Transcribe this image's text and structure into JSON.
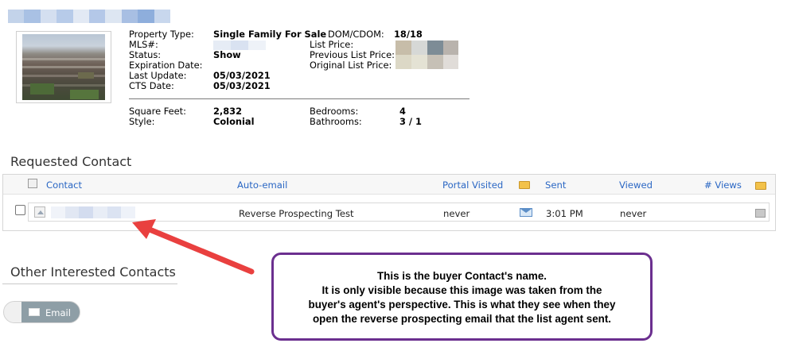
{
  "property": {
    "photo_alt": "property-photo",
    "fields": {
      "property_type_label": "Property Type:",
      "property_type_value": "Single Family For Sale",
      "dom_label": "DOM/CDOM:",
      "dom_value": "18/18",
      "mls_label": "MLS#:",
      "list_price_label": "List Price:",
      "status_label": "Status:",
      "status_value": "Show",
      "prev_price_label": "Previous List Price:",
      "expiration_label": "Expiration Date:",
      "orig_price_label": "Original List Price:",
      "last_update_label": "Last Update:",
      "last_update_value": "05/03/2021",
      "cts_label": "CTS Date:",
      "cts_value": "05/03/2021",
      "sqft_label": "Square Feet:",
      "sqft_value": "2,832",
      "bedrooms_label": "Bedrooms:",
      "bedrooms_value": "4",
      "style_label": "Style:",
      "style_value": "Colonial",
      "bathrooms_label": "Bathrooms:",
      "bathrooms_value": "3 / 1"
    }
  },
  "requested_contact": {
    "title": "Requested Contact",
    "columns": {
      "contact": "Contact",
      "auto_email": "Auto-email",
      "portal_visited": "Portal Visited",
      "sent": "Sent",
      "viewed": "Viewed",
      "views": "# Views"
    },
    "rows": [
      {
        "auto_email": "Reverse Prospecting Test",
        "portal_visited": "never",
        "sent": "3:01 PM",
        "viewed": "never"
      }
    ]
  },
  "other_interested": {
    "title": "Other Interested Contacts",
    "email_button": "Email"
  },
  "callout": {
    "lines": [
      "This is the buyer Contact's name.",
      "It is only visible because this image was taken from the",
      "buyer's agent's perspective.  This is what they see when they",
      "open the reverse prospecting email that the list agent sent."
    ]
  },
  "colors": {
    "link": "#2b67c4",
    "arrow": "#e9403f",
    "callout_border": "#6b2f8f"
  }
}
